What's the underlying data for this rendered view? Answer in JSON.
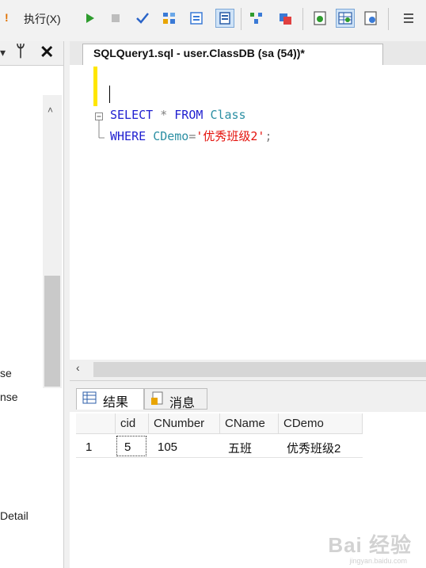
{
  "toolbar": {
    "execute_label": "执行(X)"
  },
  "left_panel": {
    "items": [
      "se",
      "nse",
      "Detail"
    ]
  },
  "tab": {
    "title": "SQLQuery1.sql - user.ClassDB (sa (54))*"
  },
  "editor": {
    "line1": {
      "kw_select": "SELECT",
      "star": "*",
      "kw_from": "FROM",
      "table": "Class"
    },
    "line2": {
      "kw_where": "WHERE",
      "column": "CDemo",
      "eq": "=",
      "value": "'优秀班级2'",
      "semicolon": ";"
    }
  },
  "results_tabs": {
    "results": "结果",
    "messages": "消息"
  },
  "grid": {
    "columns": [
      "cid",
      "CNumber",
      "CName",
      "CDemo"
    ],
    "rows": [
      {
        "rownum": "1",
        "cid": "5",
        "CNumber": "105",
        "CName": "五班",
        "CDemo": "优秀班级2"
      }
    ]
  },
  "watermark": {
    "main": "Bai 经验",
    "sub": "jingyan.baidu.com"
  },
  "colors": {
    "keyword": "#1f1fd0",
    "identifier": "#2b8fa3",
    "string": "#e4120c",
    "change_marker": "#ffe600"
  }
}
